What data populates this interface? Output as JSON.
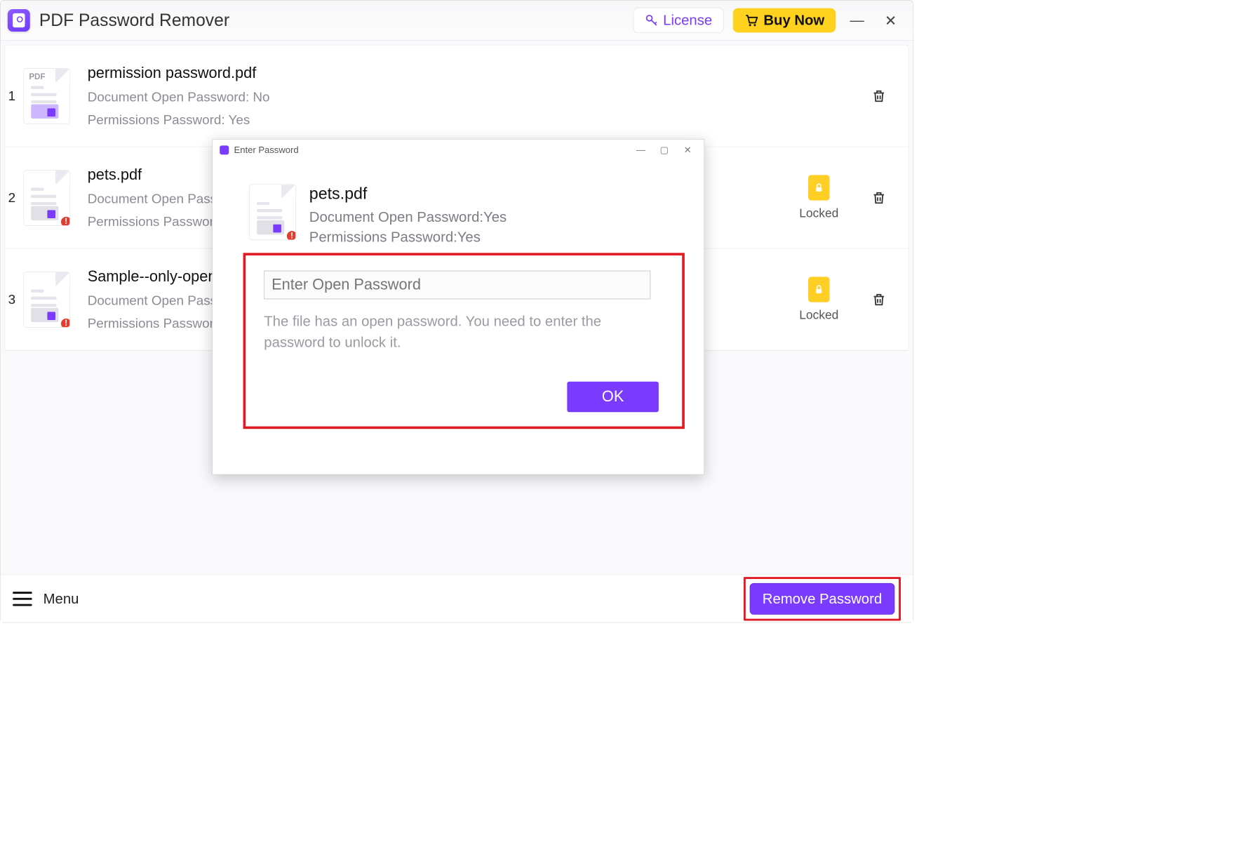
{
  "titlebar": {
    "app_name": "PDF Password Remover",
    "license_label": "License",
    "buy_label": "Buy Now"
  },
  "files": [
    {
      "name": "permission password.pdf",
      "open_pwd_line": "Document Open Password: No",
      "perm_pwd_line": "Permissions Password: Yes",
      "locked": false,
      "alert": false,
      "pdf_badge": true
    },
    {
      "name": "pets.pdf",
      "open_pwd_line": "Document Open Password: Yes",
      "perm_pwd_line": "Permissions Password: Yes",
      "locked": true,
      "alert": true,
      "pdf_badge": false
    },
    {
      "name": "Sample--only-open-password.pdf",
      "open_pwd_line": "Document Open Password: Yes",
      "perm_pwd_line": "Permissions Password: No",
      "locked": true,
      "alert": true,
      "pdf_badge": false
    }
  ],
  "locked_label": "Locked",
  "row_numbers": [
    "1",
    "2",
    "3"
  ],
  "footer": {
    "menu_label": "Menu",
    "remove_label": "Remove Password"
  },
  "dialog": {
    "title": "Enter Password",
    "file_name": "pets.pdf",
    "open_pwd_line": "Document Open Password:Yes",
    "perm_pwd_line": "Permissions Password:Yes",
    "input_placeholder": "Enter Open Password",
    "msg": "The file has an open password. You need to enter the password to unlock it.",
    "ok_label": "OK"
  }
}
